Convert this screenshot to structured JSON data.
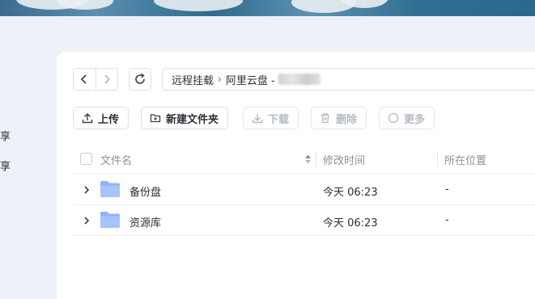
{
  "sidebar": {
    "fragments": [
      "享",
      "享"
    ]
  },
  "nav": {
    "back_icon": "chevron-left-icon",
    "forward_icon": "chevron-right-icon",
    "refresh_icon": "refresh-icon"
  },
  "breadcrumb": {
    "items": [
      "远程挂载",
      "阿里云盘 -"
    ],
    "separator": "›"
  },
  "toolbar": {
    "upload_label": "上传",
    "new_folder_label": "新建文件夹",
    "download_label": "下载",
    "delete_label": "删除",
    "more_label": "更多"
  },
  "table": {
    "columns": [
      "文件名",
      "修改时间",
      "所在位置"
    ],
    "rows": [
      {
        "name": "备份盘",
        "modified": "今天 06:23",
        "location": "-"
      },
      {
        "name": "资源库",
        "modified": "今天 06:23",
        "location": "-"
      }
    ]
  },
  "colors": {
    "folder": "#8fb3f6",
    "accent": "#4a7bd8"
  }
}
